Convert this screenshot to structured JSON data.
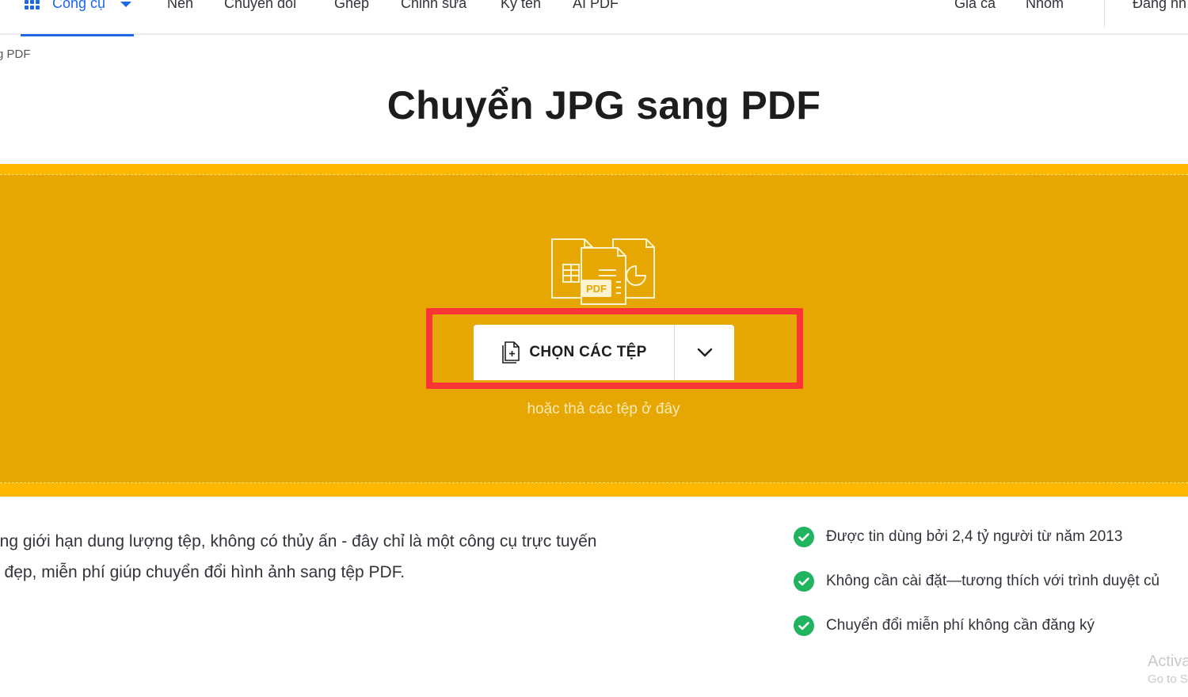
{
  "header": {
    "tools_label": "Công cụ",
    "nav": [
      "Nén",
      "Chuyển đổi",
      "Ghép",
      "Chỉnh sửa",
      "Ký tên",
      "AI PDF"
    ],
    "right_nav": [
      "Giá cả",
      "Nhóm"
    ],
    "login_label": "Đăng nh",
    "accent_color": "#1d68e6"
  },
  "breadcrumb": "g PDF",
  "page_title": "Chuyển JPG sang PDF",
  "dropzone": {
    "illustration_label": "PDF",
    "choose_button_label": "CHỌN CÁC TỆP",
    "drop_hint": "hoặc thả các tệp ở đây",
    "outer_color": "#ffb800",
    "inner_color": "#e6a703",
    "highlight_color": "#ff3434"
  },
  "description": {
    "line1": "ông giới hạn dung lượng tệp, không có thủy ấn - đây chỉ là một công cụ trực tuyến",
    "line2": "h đẹp, miễn phí giúp chuyển đổi hình ảnh sang tệp PDF."
  },
  "features": [
    "Được tin dùng bởi 2,4 tỷ người từ năm 2013",
    "Không cần cài đặt—tương thích với trình duyệt củ",
    "Chuyển đổi miễn phí không cần đăng ký"
  ],
  "watermark": {
    "line1": "Activa",
    "line2": "Go to S"
  }
}
